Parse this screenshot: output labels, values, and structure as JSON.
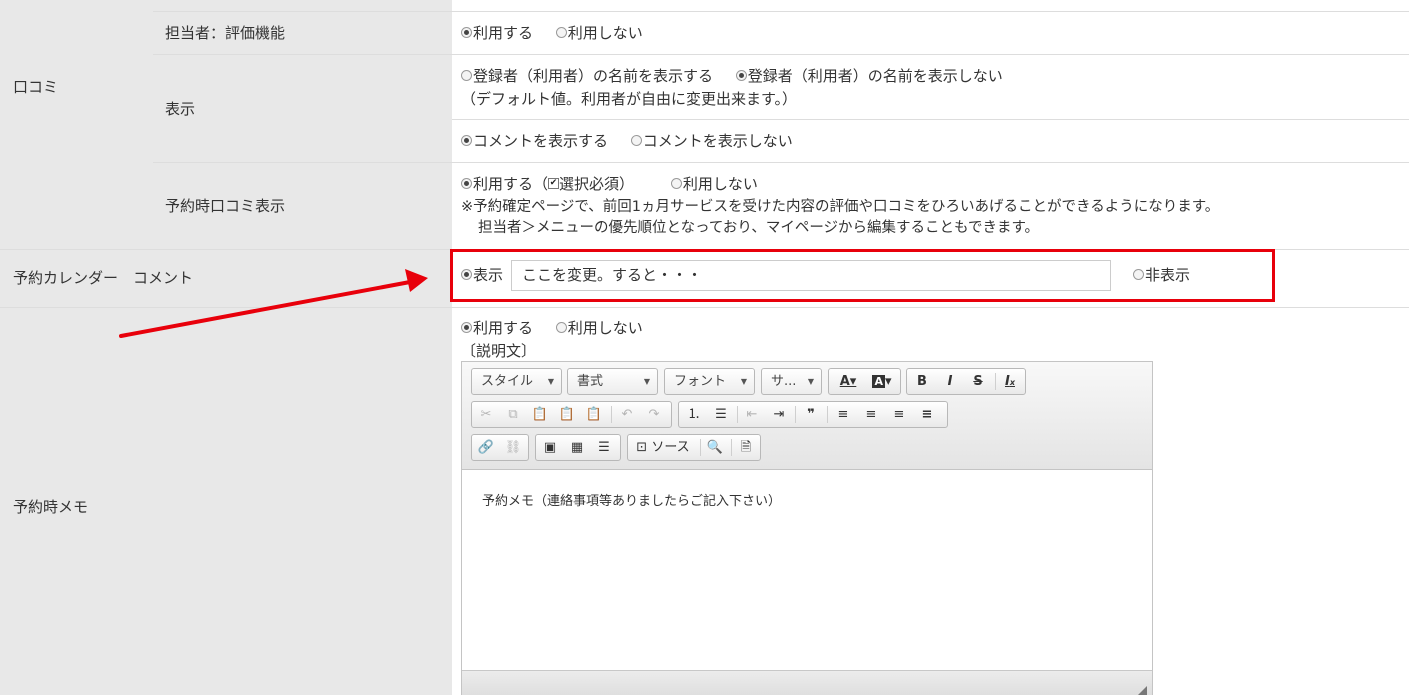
{
  "rows": {
    "kuchikomi": {
      "label": "口コミ",
      "staff": {
        "label": "担当者：評価機能",
        "options": [
          "利用する",
          "利用しない"
        ],
        "selected": "利用する"
      },
      "display": {
        "label": "表示",
        "options": [
          "登録者（利用者）の名前を表示する",
          "登録者（利用者）の名前を表示しない"
        ],
        "selected": "登録者（利用者）の名前を表示しない",
        "note": "（デフォルト値。利用者が自由に変更出来ます。）",
        "comment_options": [
          "コメントを表示する",
          "コメントを表示しない"
        ],
        "comment_selected": "コメントを表示する"
      },
      "booking_display": {
        "label": "予約時口コミ表示",
        "use_label": "利用する（",
        "required_label": "選択必須）",
        "not_use_label": "利用しない",
        "selected": "利用する",
        "required_checked": true,
        "note_line1": "※予約確定ページで、前回1ヵ月サービスを受けた内容の評価や口コミをひろいあげることができるようになります。",
        "note_line2": "担当者＞メニューの優先順位となっており、マイページから編集することもできます。"
      }
    },
    "calendar_comment": {
      "label": "予約カレンダー　コメント",
      "show_label": "表示",
      "hide_label": "非表示",
      "selected": "表示",
      "input_value": "ここを変更。すると・・・"
    },
    "booking_memo": {
      "label": "予約時メモ",
      "options": [
        "利用する",
        "利用しない"
      ],
      "selected": "利用する",
      "description_label": "〔説明文〕",
      "editor": {
        "combos": [
          "スタイル",
          "書式",
          "フォント",
          "サ..."
        ],
        "source_label": "ソース",
        "content": "予約メモ（連絡事項等ありましたらご記入下さい）"
      }
    }
  },
  "colors": {
    "label_bg": "#e8e8e8",
    "highlight": "#e8000b",
    "border": "#dddddd"
  }
}
